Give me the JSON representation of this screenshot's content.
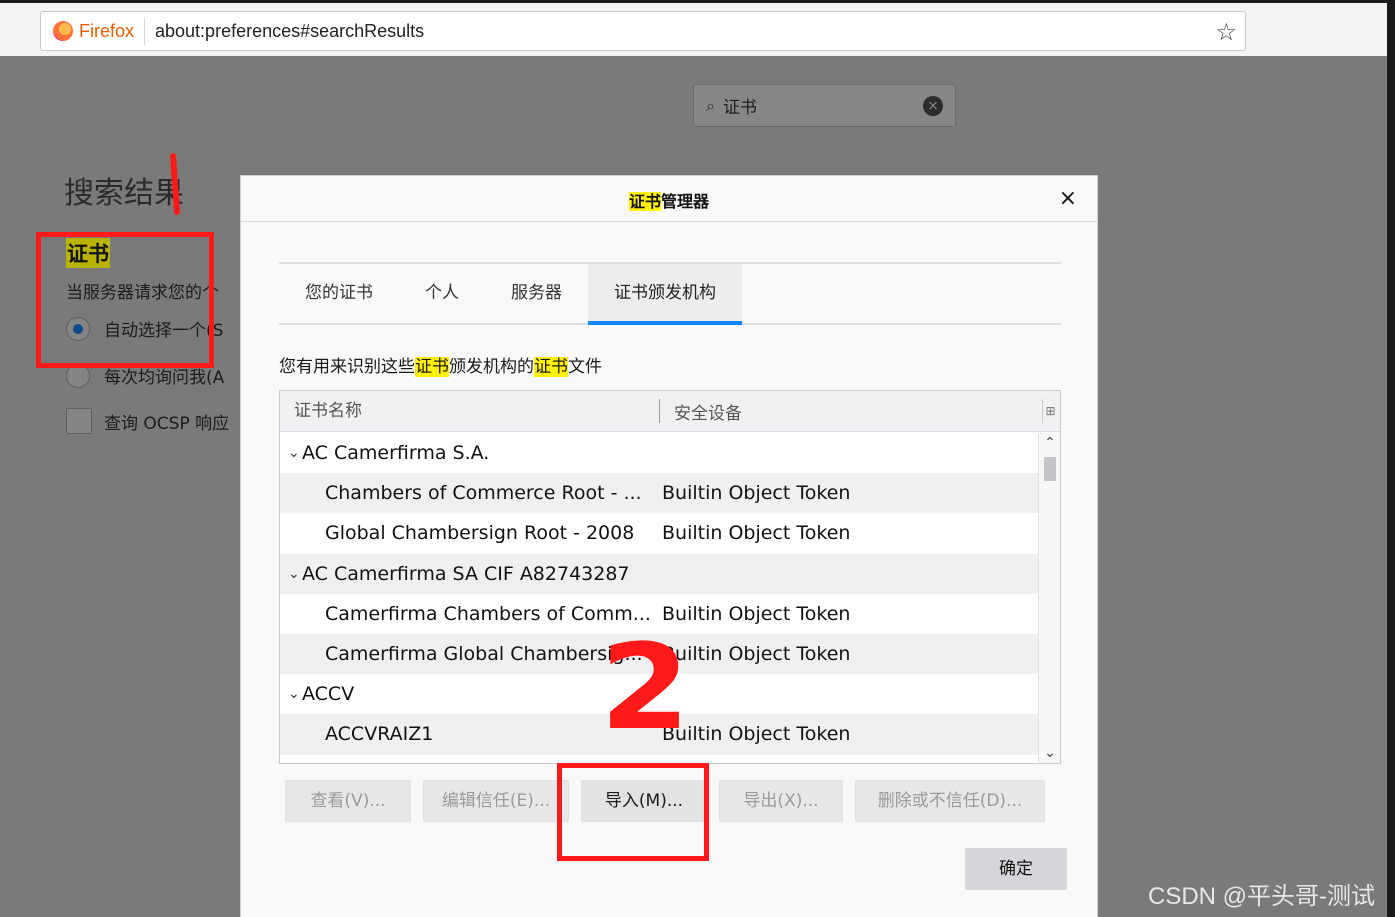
{
  "browser": {
    "brand": "Firefox",
    "url": "about:preferences#searchResults"
  },
  "search": {
    "query": "证书"
  },
  "prefs": {
    "results_title": "搜索结果",
    "section_title": "证书",
    "section_desc": "当服务器请求您的个",
    "option_auto": "自动选择一个(S",
    "option_ask": "每次均询问我(A",
    "option_ocsp": "查询 OCSP 响应"
  },
  "dialog": {
    "title_highlight": "证书",
    "title_rest": "管理器",
    "close": "×",
    "tabs": [
      "您的证书",
      "个人",
      "服务器",
      "证书颁发机构"
    ],
    "info_parts": [
      "您有用来识别这些",
      "证书",
      "颁发机构的",
      "证书",
      "文件"
    ],
    "columns": [
      "证书名称",
      "安全设备"
    ],
    "rows": [
      {
        "type": "group",
        "name": "AC Camerfirma S.A.",
        "device": ""
      },
      {
        "type": "child",
        "name": "Chambers of Commerce Root - ...",
        "device": "Builtin Object Token"
      },
      {
        "type": "child",
        "name": "Global Chambersign Root - 2008",
        "device": "Builtin Object Token"
      },
      {
        "type": "group",
        "name": "AC Camerfirma SA CIF A82743287",
        "device": ""
      },
      {
        "type": "child",
        "name": "Camerfirma Chambers of Comm...",
        "device": "Builtin Object Token"
      },
      {
        "type": "child",
        "name": "Camerfirma Global Chambersig...",
        "device": "Builtin Object Token"
      },
      {
        "type": "group",
        "name": "ACCV",
        "device": ""
      },
      {
        "type": "child",
        "name": "ACCVRAIZ1",
        "device": "Builtin Object Token"
      }
    ],
    "buttons": {
      "view": "查看(V)...",
      "edit_trust": "编辑信任(E)...",
      "import": "导入(M)...",
      "export": "导出(X)...",
      "delete": "删除或不信任(D)...",
      "ok": "确定"
    }
  },
  "annotations": {
    "step1": "1",
    "step2": "2"
  },
  "watermark": "CSDN @平头哥-测试"
}
